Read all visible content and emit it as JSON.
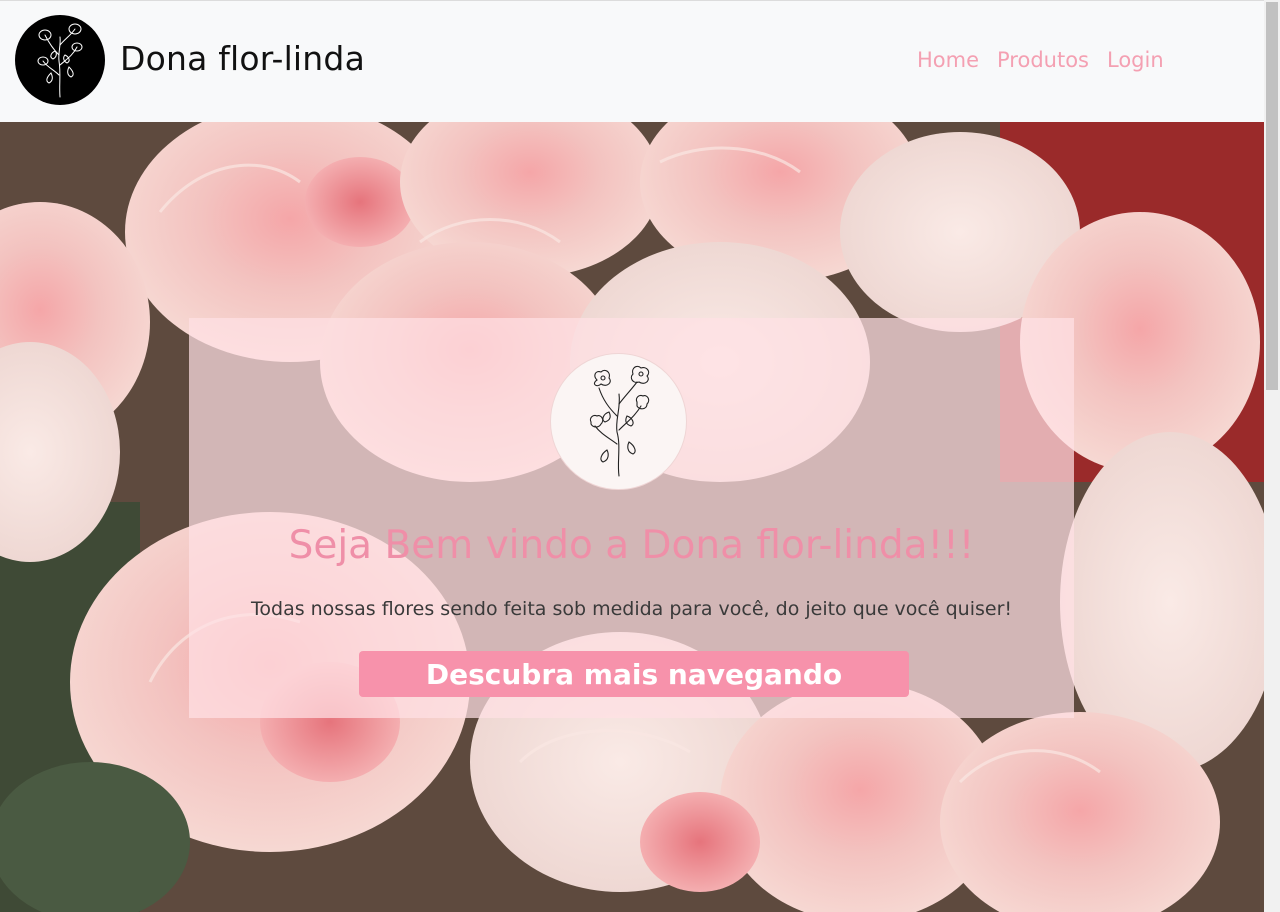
{
  "navbar": {
    "brand_name": "Dona flor-linda",
    "links": [
      {
        "label": "Home"
      },
      {
        "label": "Produtos"
      },
      {
        "label": "Login"
      }
    ]
  },
  "hero": {
    "title": "Seja Bem vindo a Dona flor-linda!!!",
    "subtitle": "Todas nossas flores sendo feita sob medida para você, do jeito que você quiser!",
    "cta_label": "Descubra mais navegando"
  },
  "colors": {
    "navbar_bg": "#f8f9fa",
    "accent_pink": "#f4a0b2",
    "title_pink": "#ef8fa8",
    "button_pink": "#f792ab",
    "card_overlay": "#ffe1e4"
  },
  "icons": {
    "brand_logo": "flower-sketch-icon",
    "card_logo": "flower-sketch-icon"
  }
}
